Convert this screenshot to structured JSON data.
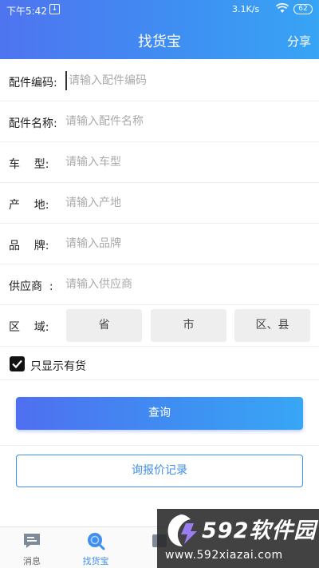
{
  "status_bar": {
    "time": "下午5:42",
    "notification": "↓",
    "speed": "3.1K/s",
    "battery": "62"
  },
  "header": {
    "title": "找货宝",
    "share_label": "分享"
  },
  "form": {
    "rows": [
      {
        "label": "配件编码:",
        "placeholder": "请输入配件编码"
      },
      {
        "label": "配件名称:",
        "placeholder": "请输入配件名称"
      },
      {
        "label": "车    型:",
        "placeholder": "请输入车型"
      },
      {
        "label": "产    地:",
        "placeholder": "请输入产地"
      },
      {
        "label": "品    牌:",
        "placeholder": "请输入品牌"
      },
      {
        "label": "供应商  :",
        "placeholder": "请输入供应商"
      }
    ],
    "region": {
      "label": "区    域:",
      "province": "省",
      "city": "市",
      "district": "区、县"
    },
    "in_stock": {
      "label": "只显示有货",
      "checked": true
    }
  },
  "actions": {
    "query_label": "查询",
    "history_label": "询报价记录"
  },
  "bottom_nav": {
    "items": [
      {
        "label": "消息",
        "icon": "message-icon"
      },
      {
        "label": "找货宝",
        "icon": "search-icon",
        "active": true
      },
      {
        "label": "",
        "icon": "unknown-icon"
      },
      {
        "label": "",
        "icon": "unknown-icon"
      },
      {
        "label": "",
        "icon": "unknown-icon"
      }
    ]
  },
  "watermark": {
    "brand": "592软件园",
    "url": "www.592xiazai.com"
  },
  "colors": {
    "accent": "#3f8ef2",
    "gradient_start": "#4f74f0",
    "gradient_end": "#37a4f4"
  }
}
